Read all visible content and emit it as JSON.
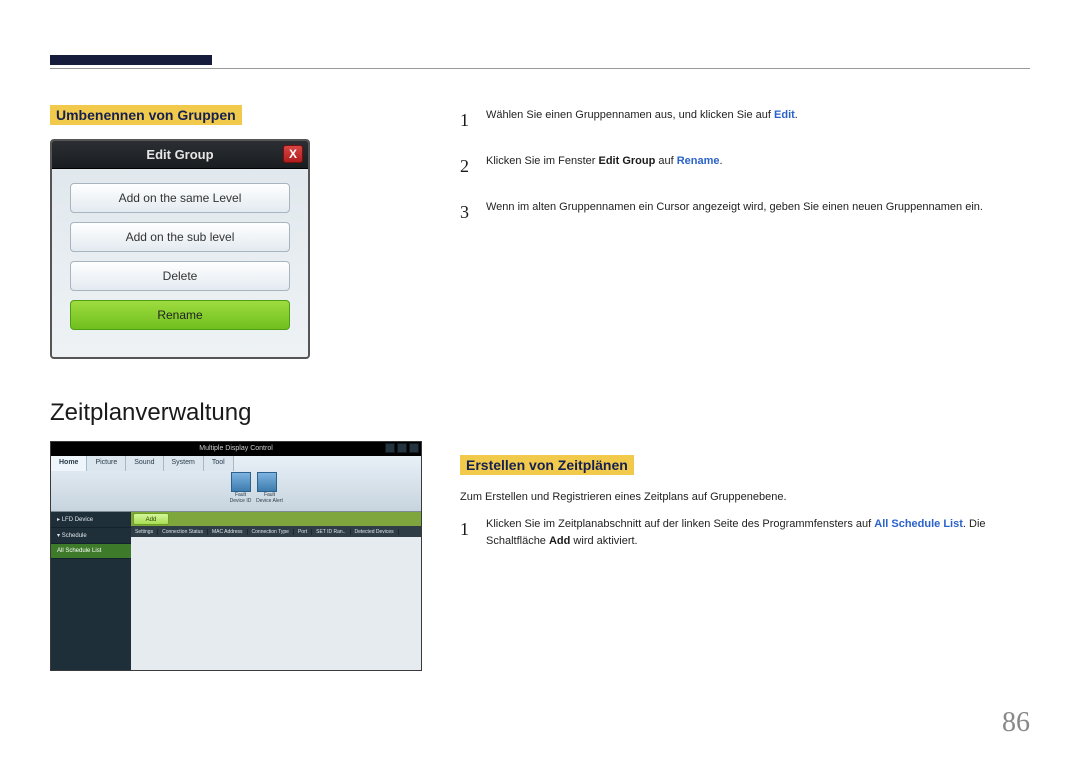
{
  "page_number": "86",
  "left": {
    "heading_rename": "Umbenennen von Gruppen",
    "heading_schedule": "Zeitplanverwaltung",
    "dialog": {
      "title": "Edit Group",
      "opt_same": "Add on the same Level",
      "opt_sub": "Add on the sub level",
      "opt_delete": "Delete",
      "opt_rename": "Rename"
    },
    "mdc": {
      "title": "Multiple Display Control",
      "tabs": [
        "Home",
        "Picture",
        "Sound",
        "System",
        "Tool"
      ],
      "side_lfd": "LFD Device",
      "side_schedule": "Schedule",
      "side_all": "All Schedule List",
      "add_btn": "Add",
      "headers": [
        "Settings",
        "Connection Status",
        "MAC Address",
        "Connection Type",
        "Port",
        "SET ID Ran..",
        "Detected Devices"
      ],
      "icon_lbl1": "Fault Device ID",
      "icon_lbl2": "Fault Device Alert"
    }
  },
  "right": {
    "step1_a": "Wählen Sie einen Gruppennamen aus, und klicken Sie auf ",
    "step1_b": "Edit",
    "step1_c": ".",
    "step2_a": "Klicken Sie im Fenster ",
    "step2_b": "Edit Group",
    "step2_c": " auf ",
    "step2_d": "Rename",
    "step2_e": ".",
    "step3": "Wenn im alten Gruppennamen ein Cursor angezeigt wird, geben Sie einen neuen Gruppennamen ein.",
    "heading_create": "Erstellen von Zeitplänen",
    "create_desc": "Zum Erstellen und Registrieren eines Zeitplans auf Gruppenebene.",
    "create1_a": "Klicken Sie im Zeitplanabschnitt auf der linken Seite des Programmfensters auf ",
    "create1_b": "All Schedule List",
    "create1_c": ". Die Schaltfläche ",
    "create1_d": "Add",
    "create1_e": " wird aktiviert."
  },
  "nums": {
    "n1": "1",
    "n2": "2",
    "n3": "3"
  }
}
